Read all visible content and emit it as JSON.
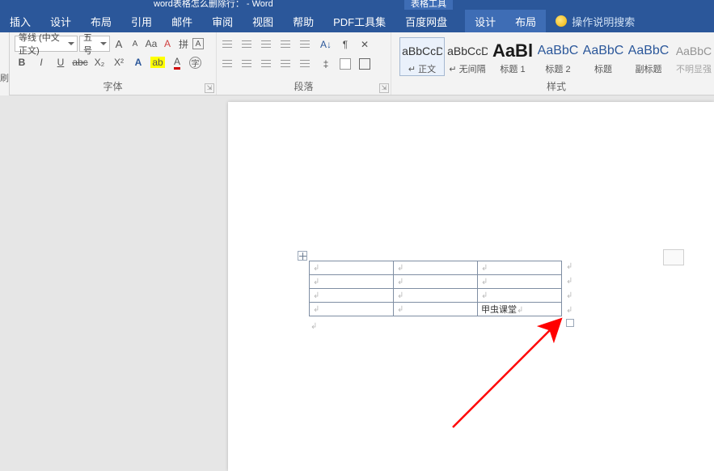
{
  "title": "word表格怎么删除行： - Word",
  "tool_context": "表格工具",
  "tabs": {
    "insert": "插入",
    "design": "设计",
    "layout": "布局",
    "references": "引用",
    "mailings": "邮件",
    "review": "审阅",
    "view": "视图",
    "help": "帮助",
    "pdftools": "PDF工具集",
    "baidu": "百度网盘",
    "ctx_design": "设计",
    "ctx_layout": "布局",
    "search": "操作说明搜索"
  },
  "font": {
    "family": "等线 (中文正文)",
    "size": "五号",
    "grow": "A",
    "shrink": "A",
    "case": "Aa",
    "clear": "A",
    "phonetic": "拼",
    "charborder": "A",
    "bold": "B",
    "italic": "I",
    "underline": "U",
    "strike": "abc",
    "sub": "X₂",
    "sup": "X²",
    "effects": "A",
    "highlight": "ab",
    "fontcolor": "A",
    "enclose": "字",
    "group": "字体"
  },
  "para": {
    "group": "段落"
  },
  "styles": {
    "group": "样式",
    "items": [
      {
        "prev": "AaBbCcDc",
        "name": "↵ 正文",
        "cls": ""
      },
      {
        "prev": "AaBbCcDc",
        "name": "↵ 无间隔",
        "cls": ""
      },
      {
        "prev": "AaBl",
        "name": "标题 1",
        "cls": "big"
      },
      {
        "prev": "AaBbC",
        "name": "标题 2",
        "cls": "h"
      },
      {
        "prev": "AaBbC",
        "name": "标题",
        "cls": "h"
      },
      {
        "prev": "AaBbC",
        "name": "副标题",
        "cls": "h"
      },
      {
        "prev": "AaBbC",
        "name": "不明显强",
        "cls": ""
      }
    ]
  },
  "leftgutter": "刷",
  "document": {
    "cell_text": "甲虫课堂",
    "mark": "↲"
  }
}
